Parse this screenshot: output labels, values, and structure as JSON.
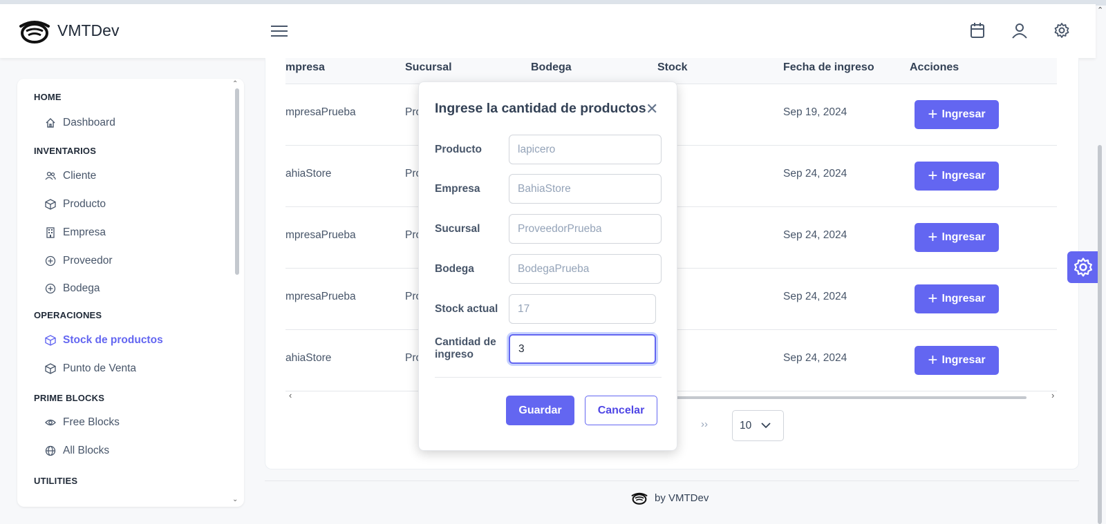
{
  "app": {
    "brand": "VMTDev"
  },
  "sidebar": {
    "sections": [
      {
        "title": "HOME",
        "items": [
          {
            "label": "Dashboard",
            "icon": "home-icon"
          }
        ]
      },
      {
        "title": "INVENTARIOS",
        "items": [
          {
            "label": "Cliente",
            "icon": "users-icon"
          },
          {
            "label": "Producto",
            "icon": "box-icon"
          },
          {
            "label": "Empresa",
            "icon": "building-icon"
          },
          {
            "label": "Proveedor",
            "icon": "plus-circle-icon"
          },
          {
            "label": "Bodega",
            "icon": "plus-circle-icon"
          }
        ]
      },
      {
        "title": "OPERACIONES",
        "items": [
          {
            "label": "Stock de productos",
            "icon": "box-icon",
            "active": true
          },
          {
            "label": "Punto de Venta",
            "icon": "box-icon"
          }
        ]
      },
      {
        "title": "PRIME BLOCKS",
        "items": [
          {
            "label": "Free Blocks",
            "icon": "eye-icon"
          },
          {
            "label": "All Blocks",
            "icon": "globe-icon"
          }
        ]
      },
      {
        "title": "UTILITIES",
        "items": []
      }
    ]
  },
  "table": {
    "headers": [
      "mpresa",
      "Sucursal",
      "Bodega",
      "Stock",
      "Fecha de ingreso",
      "Acciones"
    ],
    "rows": [
      {
        "empresa": "mpresaPrueba",
        "sucursal": "Pro",
        "fecha": "Sep 19, 2024",
        "action": "Ingresar"
      },
      {
        "empresa": "ahiaStore",
        "sucursal": "Pro",
        "fecha": "Sep 24, 2024",
        "action": "Ingresar"
      },
      {
        "empresa": "mpresaPrueba",
        "sucursal": "Pro",
        "fecha": "Sep 24, 2024",
        "action": "Ingresar"
      },
      {
        "empresa": "mpresaPrueba",
        "sucursal": "Pro",
        "fecha": "Sep 24, 2024",
        "action": "Ingresar"
      },
      {
        "empresa": "ahiaStore",
        "sucursal": "Pro",
        "fecha": "Sep 24, 2024",
        "action": "Ingresar"
      }
    ]
  },
  "pagination": {
    "next_label": "››",
    "rows_per_page": "10"
  },
  "footer": {
    "text": "by  VMTDev"
  },
  "dialog": {
    "title": "Ingrese la cantidad de productos",
    "fields": [
      {
        "label": "Producto",
        "value": "lapicero"
      },
      {
        "label": "Empresa",
        "value": "BahiaStore"
      },
      {
        "label": "Sucursal",
        "value": "ProveedorPrueba"
      },
      {
        "label": "Bodega",
        "value": "BodegaPrueba"
      },
      {
        "label": "Stock actual",
        "value": "17"
      },
      {
        "label": "Cantidad de ingreso",
        "value": "3"
      }
    ],
    "save_label": "Guardar",
    "cancel_label": "Cancelar"
  },
  "colors": {
    "accent": "#6366f1",
    "text": "#334155"
  }
}
